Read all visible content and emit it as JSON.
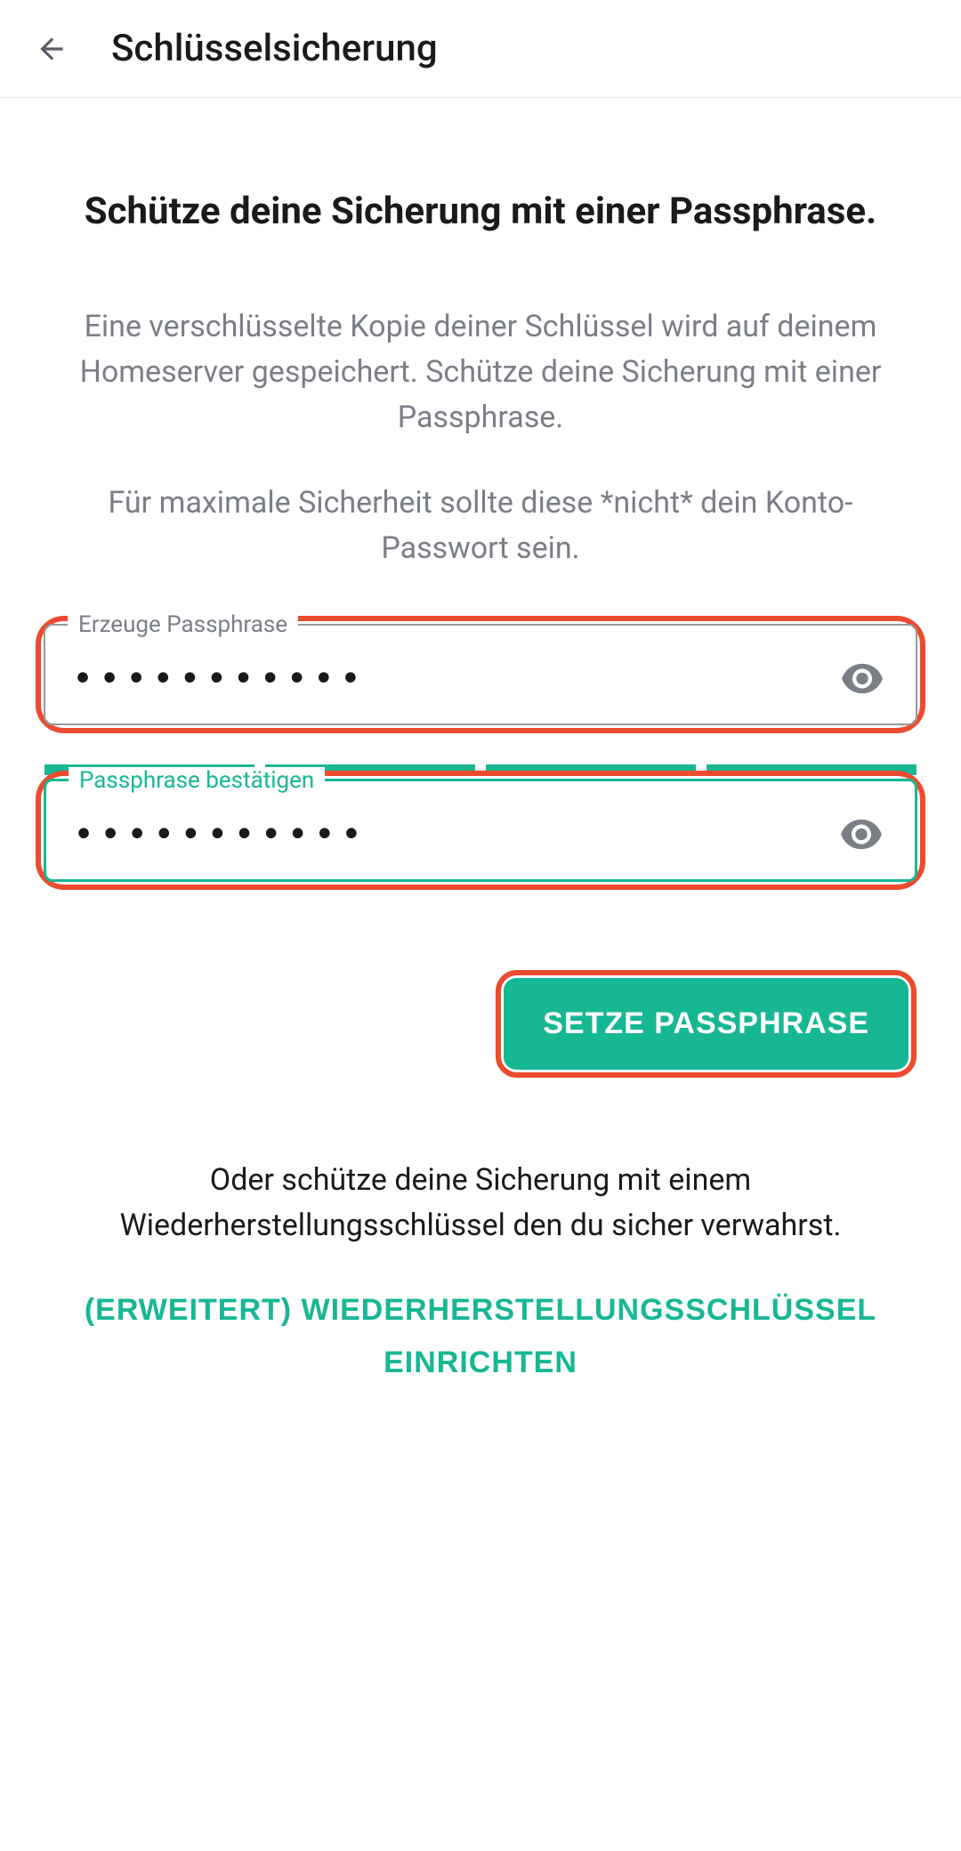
{
  "header": {
    "title": "Schlüsselsicherung"
  },
  "main": {
    "heading": "Schütze deine Sicherung mit einer Passphrase.",
    "desc1": "Eine verschlüsselte Kopie deiner Schlüssel wird auf deinem Homeserver gespeichert. Schütze deine Sicherung mit einer Passphrase.",
    "desc2": "Für maximale Sicherheit sollte diese *nicht* dein Konto-Passwort sein."
  },
  "fields": {
    "create": {
      "label": "Erzeuge Passphrase",
      "value": "•••••••••••"
    },
    "confirm": {
      "label": "Passphrase bestätigen",
      "value": "•••••••••••"
    }
  },
  "buttons": {
    "set": "SETZE PASSPHRASE",
    "alt_text": "Oder schütze deine Sicherung mit einem Wiederherstellungsschlüssel den du sicher verwahrst.",
    "advanced": "(ERWEITERT) WIEDERHERSTELLUNGSSCHLÜSSEL EINRICHTEN"
  },
  "colors": {
    "accent": "#17b794",
    "highlight": "#eb4b2f"
  }
}
